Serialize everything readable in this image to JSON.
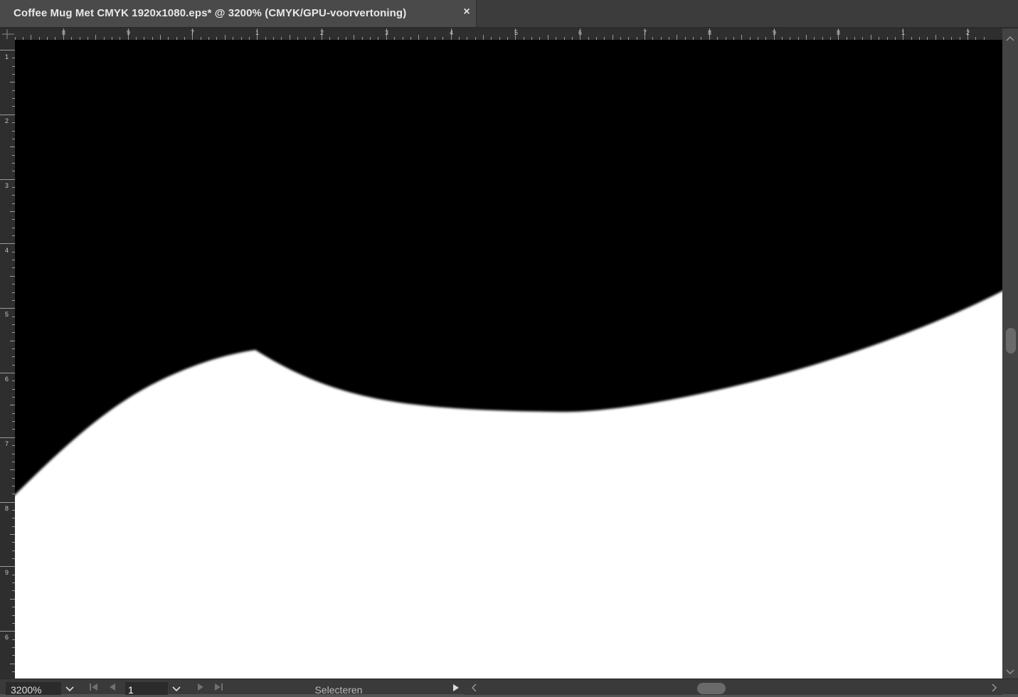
{
  "tab": {
    "title": "Coffee Mug Met CMYK 1920x1080.eps* @ 3200% (CMYK/GPU-voorvertoning)",
    "close_glyph": "×"
  },
  "rulers": {
    "horizontal_labels": [
      "8",
      "9",
      "7",
      "1",
      "2",
      "3",
      "4",
      "5",
      "6",
      "7",
      "8",
      "9",
      "8",
      "1",
      "2"
    ],
    "vertical_labels": [
      "1",
      "2",
      "3",
      "4",
      "5",
      "6",
      "7",
      "8",
      "9",
      "6"
    ]
  },
  "canvas": {
    "fill_color": "#000000",
    "background_color": "#ffffff"
  },
  "statusbar": {
    "zoom": "3200%",
    "page": "1",
    "status": "Selecteren",
    "icons": {
      "dropdown": "chevron-down-icon",
      "first": "first-page-icon",
      "prev": "previous-page-icon",
      "next": "next-page-icon",
      "last": "last-page-icon",
      "play": "play-icon"
    }
  }
}
